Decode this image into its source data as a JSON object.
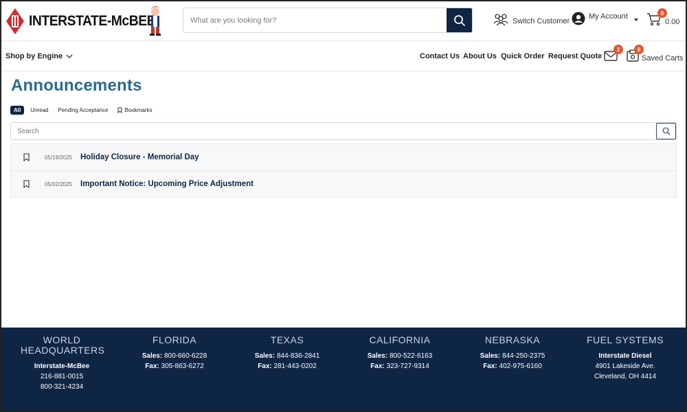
{
  "brand": {
    "name": "INTERSTATE-McBEE",
    "colors": {
      "navy": "#0f2544",
      "title_blue": "#2d6a8f",
      "badge": "#e4572e",
      "logo_red": "#d62b2b"
    }
  },
  "header": {
    "search_placeholder": "What are you looking for?",
    "switch_customer": "Switch Customer",
    "my_account": "My Account",
    "cart_count": "0",
    "cart_total": "0.00"
  },
  "nav": {
    "shop_by_engine": "Shop by Engine",
    "links": [
      "Contact Us",
      "About Us",
      "Quick Order",
      "Request Quote"
    ],
    "messages_count": "2",
    "saved_carts_count": "0",
    "saved_carts": "Saved Carts"
  },
  "main": {
    "title": "Announcements",
    "filters": [
      "All",
      "Unread",
      "Pending Acceptance",
      "Bookmarks"
    ],
    "search_placeholder": "Search",
    "announcements": [
      {
        "date": "05/19/2025",
        "title": "Holiday Closure - Memorial Day"
      },
      {
        "date": "05/02/2025",
        "title": "Important Notice: Upcoming Price Adjustment"
      }
    ]
  },
  "footer": {
    "columns": [
      {
        "heading": "WORLD HEADQUARTERS",
        "lines": [
          {
            "label": "Interstate-McBee",
            "value": ""
          },
          {
            "label": "",
            "value": "216-881-0015"
          },
          {
            "label": "",
            "value": "800-321-4234"
          }
        ]
      },
      {
        "heading": "FLORIDA",
        "lines": [
          {
            "label": "Sales:",
            "value": "800-660-6228"
          },
          {
            "label": "Fax:",
            "value": "305-863-6272"
          }
        ]
      },
      {
        "heading": "TEXAS",
        "lines": [
          {
            "label": "Sales:",
            "value": "844-836-2841"
          },
          {
            "label": "Fax:",
            "value": "281-443-0202"
          }
        ]
      },
      {
        "heading": "CALIFORNIA",
        "lines": [
          {
            "label": "Sales:",
            "value": "800-522-6163"
          },
          {
            "label": "Fax:",
            "value": "323-727-9314"
          }
        ]
      },
      {
        "heading": "NEBRASKA",
        "lines": [
          {
            "label": "Sales:",
            "value": "844-250-2375"
          },
          {
            "label": "Fax:",
            "value": "402-975-6160"
          }
        ]
      },
      {
        "heading": "FUEL SYSTEMS",
        "lines": [
          {
            "label": "Interstate Diesel",
            "value": ""
          },
          {
            "label": "",
            "value": "4901 Lakeside Ave."
          },
          {
            "label": "",
            "value": "Cleveland, OH 4414"
          }
        ]
      }
    ]
  }
}
